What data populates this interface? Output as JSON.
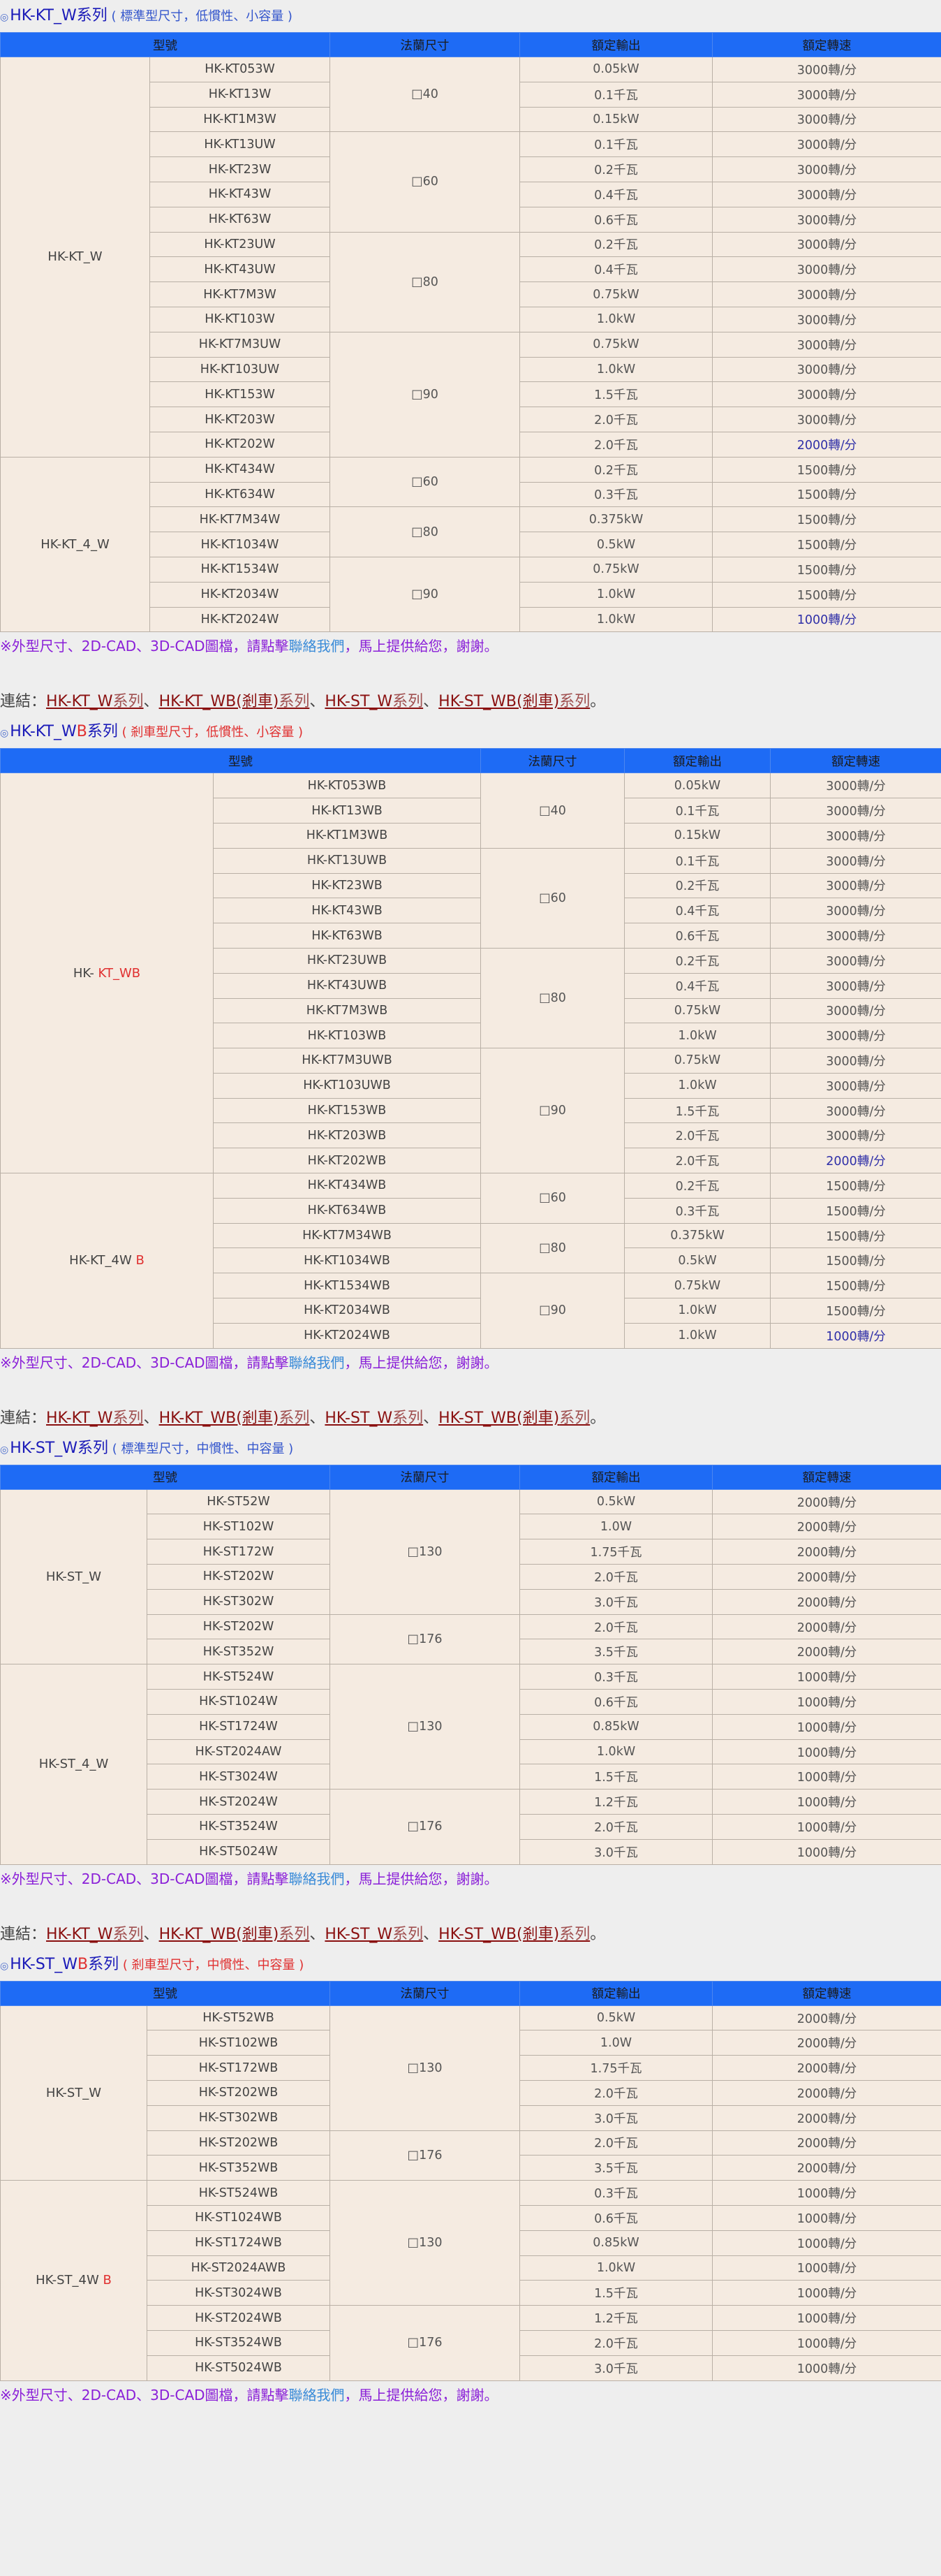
{
  "mark": "◎",
  "note_text_a": "※外型尺寸、2D-CAD、3D-CAD圖檔，請點擊",
  "note_text_b": "聯絡我們",
  "note_text_c": "，馬上提供給您，謝謝。",
  "links": {
    "prefix": "連結：",
    "items": [
      {
        "main": "HK-KT_W",
        "tail": "系列"
      },
      {
        "main": "HK-KT_WB(剎車)",
        "tail": "系列"
      },
      {
        "main": "HK-ST_W",
        "tail": "系列"
      },
      {
        "main": "HK-ST_WB(剎車)",
        "tail": "系列"
      }
    ],
    "sep": "、",
    "end": "。"
  },
  "header": {
    "model": "型號",
    "flange": "法蘭尺寸",
    "output": "額定輸出",
    "speed": "額定轉速"
  },
  "sections": [
    {
      "title_a": "HK-KT_W",
      "title_b": "",
      "title_c": "系列",
      "subtitle": "( 標準型尺寸，低慣性、小容量 )",
      "groups": [
        {
          "name": "HK-KT_W",
          "name_red": "",
          "rows": [
            [
              "HK-KT053W",
              "□40",
              "0.05kW",
              "3000轉/分"
            ],
            [
              "HK-KT13W",
              "",
              "0.1千瓦",
              "3000轉/分"
            ],
            [
              "HK-KT1M3W",
              "",
              "0.15kW",
              "3000轉/分"
            ],
            [
              "HK-KT13UW",
              "□60",
              "0.1千瓦",
              "3000轉/分"
            ],
            [
              "HK-KT23W",
              "",
              "0.2千瓦",
              "3000轉/分"
            ],
            [
              "HK-KT43W",
              "",
              "0.4千瓦",
              "3000轉/分"
            ],
            [
              "HK-KT63W",
              "",
              "0.6千瓦",
              "3000轉/分"
            ],
            [
              "HK-KT23UW",
              "□80",
              "0.2千瓦",
              "3000轉/分"
            ],
            [
              "HK-KT43UW",
              "",
              "0.4千瓦",
              "3000轉/分"
            ],
            [
              "HK-KT7M3W",
              "",
              "0.75kW",
              "3000轉/分"
            ],
            [
              "HK-KT103W",
              "",
              "1.0kW",
              "3000轉/分"
            ],
            [
              "HK-KT7M3UW",
              "□90",
              "0.75kW",
              "3000轉/分"
            ],
            [
              "HK-KT103UW",
              "",
              "1.0kW",
              "3000轉/分"
            ],
            [
              "HK-KT153W",
              "",
              "1.5千瓦",
              "3000轉/分"
            ],
            [
              "HK-KT203W",
              "",
              "2.0千瓦",
              "3000轉/分"
            ],
            [
              "HK-KT202W",
              "",
              "2.0千瓦",
              "2000轉/分"
            ]
          ]
        },
        {
          "name": "HK-KT_4_W",
          "name_red": "",
          "rows": [
            [
              "HK-KT434W",
              "□60",
              "0.2千瓦",
              "1500轉/分"
            ],
            [
              "HK-KT634W",
              "",
              "0.3千瓦",
              "1500轉/分"
            ],
            [
              "HK-KT7M34W",
              "□80",
              "0.375kW",
              "1500轉/分"
            ],
            [
              "HK-KT1034W",
              "",
              "0.5kW",
              "1500轉/分"
            ],
            [
              "HK-KT1534W",
              "□90",
              "0.75kW",
              "1500轉/分"
            ],
            [
              "HK-KT2034W",
              "",
              "1.0kW",
              "1500轉/分"
            ],
            [
              "HK-KT2024W",
              "",
              "1.0kW",
              "1000轉/分"
            ]
          ]
        }
      ]
    },
    {
      "title_a": "HK-KT_W",
      "title_b": "B",
      "title_c": "系列",
      "subtitle": "( 剎車型尺寸，低慣性、小容量 )",
      "groups": [
        {
          "name": "HK- ",
          "name_red": "KT_WB",
          "rows": [
            [
              "HK-KT053WB",
              "□40",
              "0.05kW",
              "3000轉/分"
            ],
            [
              "HK-KT13WB",
              "",
              "0.1千瓦",
              "3000轉/分"
            ],
            [
              "HK-KT1M3WB",
              "",
              "0.15kW",
              "3000轉/分"
            ],
            [
              "HK-KT13UWB",
              "□60",
              "0.1千瓦",
              "3000轉/分"
            ],
            [
              "HK-KT23WB",
              "",
              "0.2千瓦",
              "3000轉/分"
            ],
            [
              "HK-KT43WB",
              "",
              "0.4千瓦",
              "3000轉/分"
            ],
            [
              "HK-KT63WB",
              "",
              "0.6千瓦",
              "3000轉/分"
            ],
            [
              "HK-KT23UWB",
              "□80",
              "0.2千瓦",
              "3000轉/分"
            ],
            [
              "HK-KT43UWB",
              "",
              "0.4千瓦",
              "3000轉/分"
            ],
            [
              "HK-KT7M3WB",
              "",
              "0.75kW",
              "3000轉/分"
            ],
            [
              "HK-KT103WB",
              "",
              "1.0kW",
              "3000轉/分"
            ],
            [
              "HK-KT7M3UWB",
              "□90",
              "0.75kW",
              "3000轉/分"
            ],
            [
              "HK-KT103UWB",
              "",
              "1.0kW",
              "3000轉/分"
            ],
            [
              "HK-KT153WB",
              "",
              "1.5千瓦",
              "3000轉/分"
            ],
            [
              "HK-KT203WB",
              "",
              "2.0千瓦",
              "3000轉/分"
            ],
            [
              "HK-KT202WB",
              "",
              "2.0千瓦",
              "2000轉/分"
            ]
          ]
        },
        {
          "name": "HK-KT_4W ",
          "name_red": "B",
          "rows": [
            [
              "HK-KT434WB",
              "□60",
              "0.2千瓦",
              "1500轉/分"
            ],
            [
              "HK-KT634WB",
              "",
              "0.3千瓦",
              "1500轉/分"
            ],
            [
              "HK-KT7M34WB",
              "□80",
              "0.375kW",
              "1500轉/分"
            ],
            [
              "HK-KT1034WB",
              "",
              "0.5kW",
              "1500轉/分"
            ],
            [
              "HK-KT1534WB",
              "□90",
              "0.75kW",
              "1500轉/分"
            ],
            [
              "HK-KT2034WB",
              "",
              "1.0kW",
              "1500轉/分"
            ],
            [
              "HK-KT2024WB",
              "",
              "1.0kW",
              "1000轉/分"
            ]
          ]
        }
      ]
    },
    {
      "title_a": "HK-ST_W",
      "title_b": "",
      "title_c": "系列",
      "subtitle": "( 標準型尺寸，中慣性、中容量 )",
      "groups": [
        {
          "name": "HK-ST_W",
          "name_red": "",
          "rows": [
            [
              "HK-ST52W",
              "□130",
              "0.5kW",
              "2000轉/分"
            ],
            [
              "HK-ST102W",
              "",
              "1.0W",
              "2000轉/分"
            ],
            [
              "HK-ST172W",
              "",
              "1.75千瓦",
              "2000轉/分"
            ],
            [
              "HK-ST202W",
              "",
              "2.0千瓦",
              "2000轉/分"
            ],
            [
              "HK-ST302W",
              "",
              "3.0千瓦",
              "2000轉/分"
            ],
            [
              "HK-ST202W",
              "□176",
              "2.0千瓦",
              "2000轉/分"
            ],
            [
              "HK-ST352W",
              "",
              "3.5千瓦",
              "2000轉/分"
            ]
          ]
        },
        {
          "name": "HK-ST_4_W",
          "name_red": "",
          "rows": [
            [
              "HK-ST524W",
              "□130",
              "0.3千瓦",
              "1000轉/分"
            ],
            [
              "HK-ST1024W",
              "",
              "0.6千瓦",
              "1000轉/分"
            ],
            [
              "HK-ST1724W",
              "",
              "0.85kW",
              "1000轉/分"
            ],
            [
              "HK-ST2024AW",
              "",
              "1.0kW",
              "1000轉/分"
            ],
            [
              "HK-ST3024W",
              "",
              "1.5千瓦",
              "1000轉/分"
            ],
            [
              "HK-ST2024W",
              "□176",
              "1.2千瓦",
              "1000轉/分"
            ],
            [
              "HK-ST3524W",
              "",
              "2.0千瓦",
              "1000轉/分"
            ],
            [
              "HK-ST5024W",
              "",
              "3.0千瓦",
              "1000轉/分"
            ]
          ]
        }
      ]
    },
    {
      "title_a": "HK-ST_W",
      "title_b": "B",
      "title_c": "系列",
      "subtitle": "( 剎車型尺寸，中慣性、中容量 )",
      "groups": [
        {
          "name": "HK-ST_W",
          "name_red": "",
          "rows": [
            [
              "HK-ST52WB",
              "□130",
              "0.5kW",
              "2000轉/分"
            ],
            [
              "HK-ST102WB",
              "",
              "1.0W",
              "2000轉/分"
            ],
            [
              "HK-ST172WB",
              "",
              "1.75千瓦",
              "2000轉/分"
            ],
            [
              "HK-ST202WB",
              "",
              "2.0千瓦",
              "2000轉/分"
            ],
            [
              "HK-ST302WB",
              "",
              "3.0千瓦",
              "2000轉/分"
            ],
            [
              "HK-ST202WB",
              "□176",
              "2.0千瓦",
              "2000轉/分"
            ],
            [
              "HK-ST352WB",
              "",
              "3.5千瓦",
              "2000轉/分"
            ]
          ]
        },
        {
          "name": "HK-ST_4W ",
          "name_red": "B",
          "rows": [
            [
              "HK-ST524WB",
              "□130",
              "0.3千瓦",
              "1000轉/分"
            ],
            [
              "HK-ST1024WB",
              "",
              "0.6千瓦",
              "1000轉/分"
            ],
            [
              "HK-ST1724WB",
              "",
              "0.85kW",
              "1000轉/分"
            ],
            [
              "HK-ST2024AWB",
              "",
              "1.0kW",
              "1000轉/分"
            ],
            [
              "HK-ST3024WB",
              "",
              "1.5千瓦",
              "1000轉/分"
            ],
            [
              "HK-ST2024WB",
              "□176",
              "1.2千瓦",
              "1000轉/分"
            ],
            [
              "HK-ST3524WB",
              "",
              "2.0千瓦",
              "1000轉/分"
            ],
            [
              "HK-ST5024WB",
              "",
              "3.0千瓦",
              "1000轉/分"
            ]
          ]
        }
      ]
    }
  ]
}
